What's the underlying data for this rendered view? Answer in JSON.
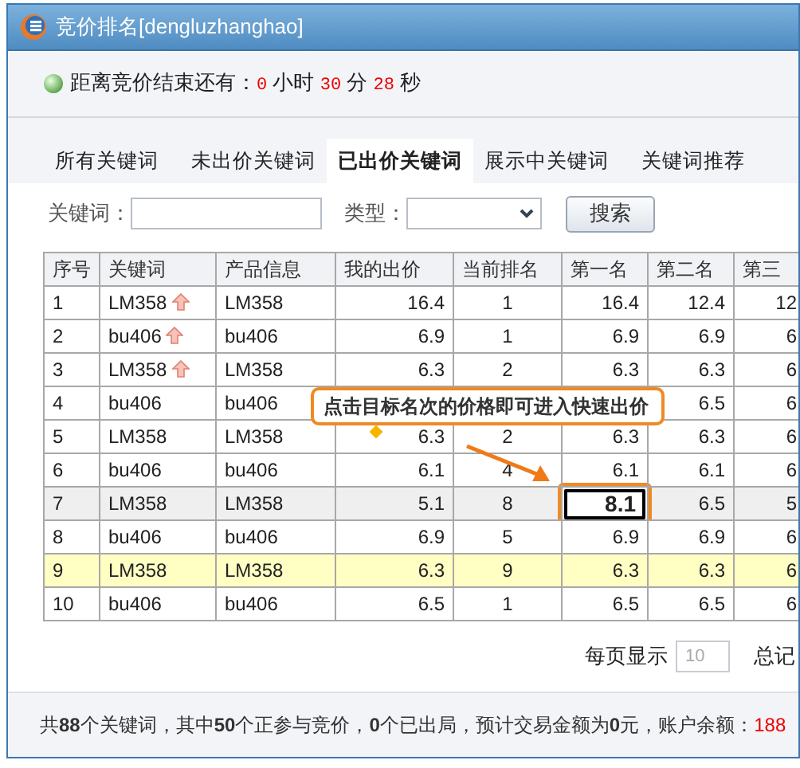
{
  "window": {
    "title": "竞价排名[dengluzhanghao]"
  },
  "countdown": {
    "label": "距离竞价结束还有：",
    "hours": "0",
    "hours_unit": "小时",
    "minutes": "30",
    "minutes_unit": "分",
    "seconds": "28",
    "seconds_unit": "秒"
  },
  "tabs": [
    {
      "label": "所有关键词",
      "selected": false
    },
    {
      "label": "未出价关键词",
      "selected": false
    },
    {
      "label": "已出价关键词",
      "selected": true
    },
    {
      "label": "展示中关键词",
      "selected": false
    },
    {
      "label": "关键词推荐",
      "selected": false
    }
  ],
  "search": {
    "keyword_label": "关键词：",
    "type_label": "类型：",
    "button": "搜索"
  },
  "table": {
    "columns": [
      "序号",
      "关键词",
      "产品信息",
      "我的出价",
      "当前排名",
      "第一名",
      "第二名",
      "第三"
    ],
    "rows": [
      {
        "cells": [
          "1",
          "LM358",
          "LM358",
          "16.4",
          "1",
          "16.4",
          "12.4",
          "12"
        ],
        "trend_up": true,
        "hovered": false,
        "selected": false,
        "editing": false
      },
      {
        "cells": [
          "2",
          "bu406",
          "bu406",
          "6.9",
          "1",
          "6.9",
          "6.9",
          "6"
        ],
        "trend_up": true,
        "hovered": false,
        "selected": false,
        "editing": false
      },
      {
        "cells": [
          "3",
          "LM358",
          "LM358",
          "6.3",
          "2",
          "6.3",
          "6.3",
          "6"
        ],
        "trend_up": true,
        "hovered": false,
        "selected": false,
        "editing": false
      },
      {
        "cells": [
          "4",
          "bu406",
          "bu406",
          "",
          "",
          "",
          "6.5",
          "6"
        ],
        "trend_up": false,
        "hovered": false,
        "selected": false,
        "editing": false
      },
      {
        "cells": [
          "5",
          "LM358",
          "LM358",
          "6.3",
          "2",
          "6.3",
          "6.3",
          "6"
        ],
        "trend_up": false,
        "hovered": false,
        "selected": false,
        "editing": false
      },
      {
        "cells": [
          "6",
          "bu406",
          "bu406",
          "6.1",
          "4",
          "6.1",
          "6.1",
          "6"
        ],
        "trend_up": false,
        "hovered": false,
        "selected": false,
        "editing": false
      },
      {
        "cells": [
          "7",
          "LM358",
          "LM358",
          "5.1",
          "8",
          "8.1",
          "6.5",
          "5"
        ],
        "trend_up": false,
        "hovered": true,
        "selected": false,
        "editing": true
      },
      {
        "cells": [
          "8",
          "bu406",
          "bu406",
          "6.9",
          "5",
          "6.9",
          "6.9",
          "6"
        ],
        "trend_up": false,
        "hovered": false,
        "selected": false,
        "editing": false
      },
      {
        "cells": [
          "9",
          "LM358",
          "LM358",
          "6.3",
          "9",
          "6.3",
          "6.3",
          "6"
        ],
        "trend_up": false,
        "hovered": false,
        "selected": true,
        "editing": false
      },
      {
        "cells": [
          "10",
          "bu406",
          "bu406",
          "6.5",
          "1",
          "6.5",
          "6.5",
          "6"
        ],
        "trend_up": false,
        "hovered": false,
        "selected": false,
        "editing": false
      }
    ]
  },
  "tooltip": "点击目标名次的价格即可进入快速出价",
  "pager": {
    "per_page_label": "每页显示",
    "per_page": "10",
    "total_label": "总记"
  },
  "summary": {
    "text": "共**88**个关键词，其中**50**个正参与竞价，**0**个已出局，预计交易金额为**0**元，账户余额：",
    "balance": "188"
  }
}
